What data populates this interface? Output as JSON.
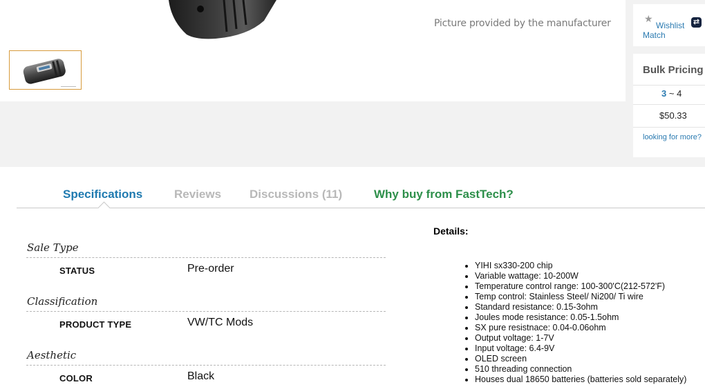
{
  "gallery": {
    "picture_credit": "Picture provided by the manufacturer"
  },
  "wishlist": {
    "wishlist_label": "Wishlist",
    "match_label": "Match",
    "wishlist_icon": "star-icon",
    "match_icon": "price-match-icon"
  },
  "bulk_pricing": {
    "title": "Bulk Pricing",
    "qty_low": "3",
    "qty_sep": " ~ ",
    "qty_high": "4",
    "price": "$50.33",
    "more_link": "looking for more?"
  },
  "tabs": [
    {
      "label": "Specifications"
    },
    {
      "label": "Reviews"
    },
    {
      "label": "Discussions (11)"
    },
    {
      "label": "Why buy from FastTech?"
    }
  ],
  "specs": [
    {
      "heading": "Sale Type",
      "key": "STATUS",
      "value": "Pre-order"
    },
    {
      "heading": "Classification",
      "key": "PRODUCT TYPE",
      "value": "VW/TC Mods"
    },
    {
      "heading": "Aesthetic",
      "key": "COLOR",
      "value": "Black"
    }
  ],
  "details": {
    "title": "Details:",
    "items": [
      "YIHI sx330-200 chip",
      "Variable wattage: 10-200W",
      "Temperature control range: 100-300'C(212-572'F)",
      "Temp control: Stainless Steel/ Ni200/ Ti wire",
      "Standard resistance: 0.15-3ohm",
      "Joules mode resistance: 0.05-1.5ohm",
      "SX pure resistnace: 0.04-0.06ohm",
      "Output voltage: 1-7V",
      "Input voltage: 6.4-9V",
      "OLED screen",
      "510 threading connection",
      "Houses dual 18650 batteries (batteries sold separately)"
    ]
  },
  "colors": {
    "link_blue": "#2a7ab0",
    "tab_active": "#1f7ab0",
    "tab_inactive": "#b8b8b8",
    "tab_why": "#2d8f4a",
    "thumb_border": "#d79a3b",
    "panel_bg": "#f2f2f2"
  }
}
